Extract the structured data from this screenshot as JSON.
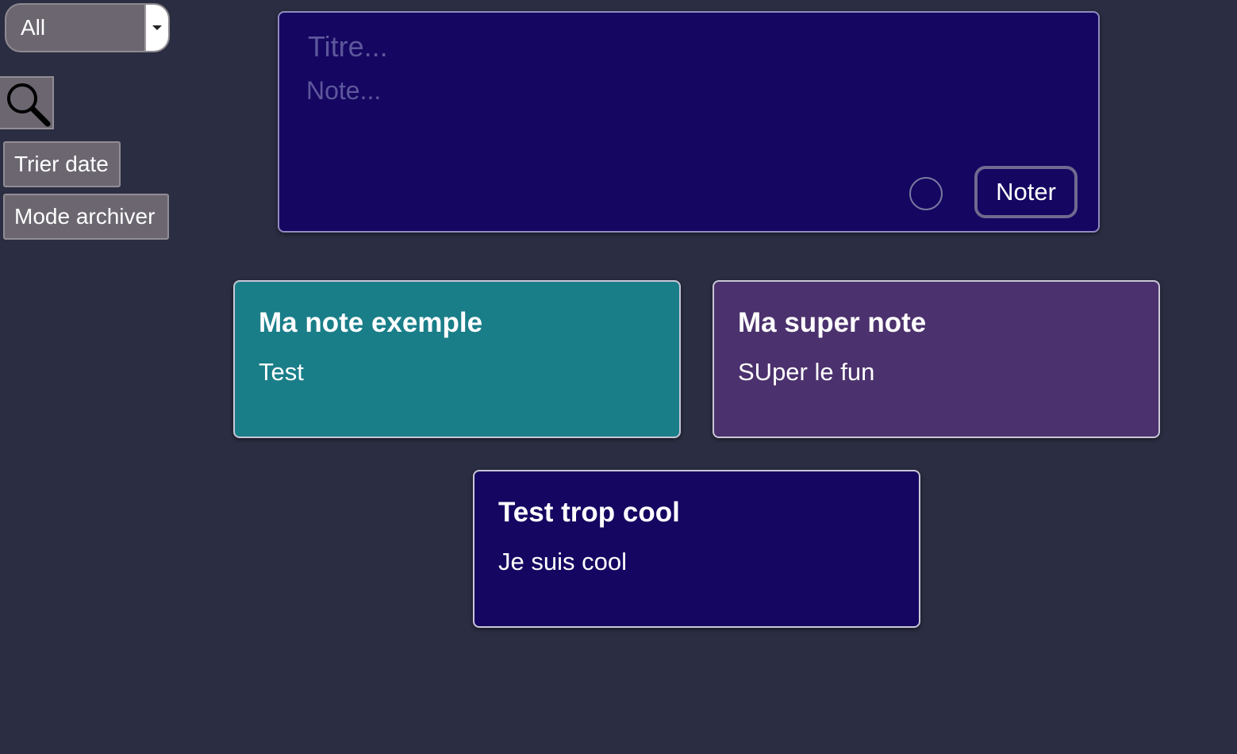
{
  "sidebar": {
    "filter": {
      "selected": "All"
    },
    "search_icon": "magnifier-icon",
    "sort_date_label": "Trier date",
    "archive_mode_label": "Mode archiver"
  },
  "composer": {
    "title_placeholder": "Titre...",
    "note_placeholder": "Note...",
    "submit_label": "Noter"
  },
  "notes": [
    {
      "title": "Ma note exemple",
      "body": "Test",
      "color": "#1a7e89"
    },
    {
      "title": "Ma super note",
      "body": "SUper le fun",
      "color": "#4b316d"
    },
    {
      "title": "Test trop cool",
      "body": "Je suis cool",
      "color": "#140661"
    }
  ],
  "colors": {
    "background": "#2b2d42",
    "composer_bg": "#140661",
    "sidebar_button_bg": "#6b6670"
  }
}
